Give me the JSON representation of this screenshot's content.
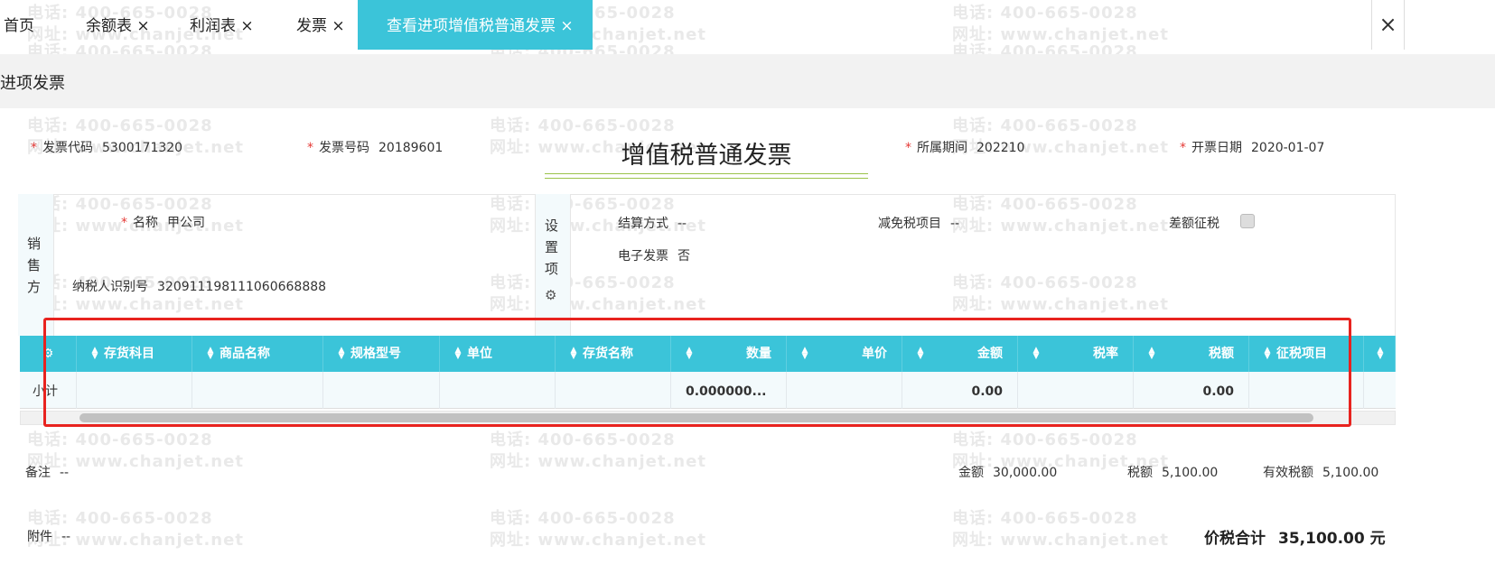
{
  "watermark": {
    "line1": "电话: 400-665-0028",
    "line2": "网址: www.chanjet.net"
  },
  "tabs": [
    {
      "label": "首页",
      "closable": false
    },
    {
      "label": "余额表",
      "closable": true
    },
    {
      "label": "利润表",
      "closable": true
    },
    {
      "label": "发票",
      "closable": true
    },
    {
      "label": "查看进项增值税普通发票",
      "closable": true,
      "active": true
    }
  ],
  "close_symbol": "×",
  "page_title": "进项发票",
  "header": {
    "invoice_code": {
      "label": "发票代码",
      "value": "5300171320"
    },
    "invoice_number": {
      "label": "发票号码",
      "value": "20189601"
    },
    "title": "增值税普通发票",
    "period": {
      "label": "所属期间",
      "value": "202210"
    },
    "issue_date": {
      "label": "开票日期",
      "value": "2020-01-07"
    }
  },
  "seller": {
    "section_label": "销售方",
    "name": {
      "label": "名称",
      "value": "甲公司"
    },
    "tax_id": {
      "label": "纳税人识别号",
      "value": "320911198111060668888"
    }
  },
  "settings": {
    "label": "设置项",
    "settlement": {
      "label": "结算方式",
      "value": "--"
    },
    "exemption": {
      "label": "减免税项目",
      "value": "--"
    },
    "diff_tax": {
      "label": "差额征税",
      "checked": false
    },
    "e_invoice": {
      "label": "电子发票",
      "value": "否"
    }
  },
  "table": {
    "columns": [
      "存货科目",
      "商品名称",
      "规格型号",
      "单位",
      "存货名称",
      "数量",
      "单价",
      "金额",
      "税率",
      "税额",
      "征税项目"
    ],
    "subtotal": {
      "label": "小计",
      "quantity": "0.000000...",
      "amount": "0.00",
      "tax": "0.00"
    }
  },
  "footer": {
    "remark": {
      "label": "备注",
      "value": "--"
    },
    "amount": {
      "label": "金额",
      "value": "30,000.00"
    },
    "tax": {
      "label": "税额",
      "value": "5,100.00"
    },
    "effective_tax": {
      "label": "有效税额",
      "value": "5,100.00"
    },
    "attachment": {
      "label": "附件",
      "value": "--"
    },
    "total": {
      "label": "价税合计",
      "value": "35,100.00 元"
    }
  },
  "colors": {
    "accent": "#3bc4d9",
    "highlight": "#e8231f",
    "title_underline": "#9bc34a"
  }
}
